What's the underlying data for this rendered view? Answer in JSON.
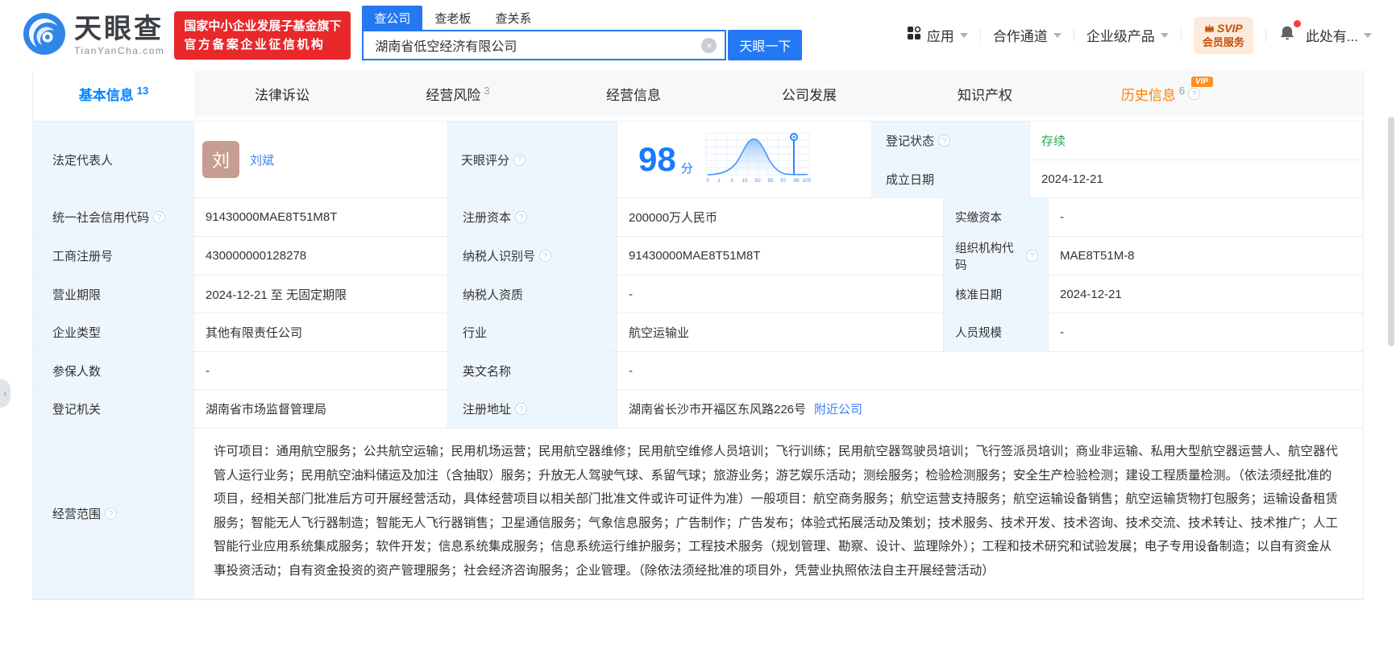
{
  "colors": {
    "primary": "#2478f2",
    "active_tab": "#0084ff",
    "status_green": "#2bab4e",
    "history_orange": "#ff8000",
    "label_bg": "#eef6fd",
    "badge_red": "#e8282b",
    "score_blue": "#187aff"
  },
  "icons": {
    "help_glyph": "?",
    "clear_glyph": "×",
    "side_toggle_glyph": "‹"
  },
  "header": {
    "logo": {
      "title": "天眼查",
      "domain": "TianYanCha.com"
    },
    "cert_badge": {
      "line1": "国家中小企业发展子基金旗下",
      "line2": "官方备案企业征信机构"
    },
    "search": {
      "tabs": [
        {
          "label": "查公司",
          "active": true
        },
        {
          "label": "查老板",
          "active": false
        },
        {
          "label": "查关系",
          "active": false
        }
      ],
      "value": "湖南省低空经济有限公司",
      "button": "天眼一下"
    },
    "nav": {
      "apps": "应用",
      "partner": "合作通道",
      "enterprise": "企业级产品",
      "vip_top": "SVIP",
      "vip_bottom": "会员服务",
      "account": "此处有..."
    }
  },
  "tabs": [
    {
      "label": "基本信息",
      "count": "13"
    },
    {
      "label": "法律诉讼",
      "count": ""
    },
    {
      "label": "经营风险",
      "count": "3"
    },
    {
      "label": "经营信息",
      "count": ""
    },
    {
      "label": "公司发展",
      "count": ""
    },
    {
      "label": "知识产权",
      "count": ""
    },
    {
      "label": "历史信息",
      "count": "6",
      "vip_badge": "VIP"
    }
  ],
  "profile": {
    "legal_rep": {
      "label": "法定代表人",
      "avatar": "刘",
      "name": "刘斌"
    },
    "reg_status": {
      "label": "登记状态",
      "value": "存续"
    },
    "establish_date": {
      "label": "成立日期",
      "value": "2024-12-21"
    },
    "score": {
      "label": "天眼评分",
      "value": "98",
      "unit": "分",
      "chart": {
        "type": "area",
        "marker_value": 98,
        "ticks": [
          "0",
          "1",
          "3",
          "15",
          "50",
          "85",
          "97",
          "99",
          "100"
        ]
      }
    },
    "credit_code": {
      "label": "统一社会信用代码",
      "value": "91430000MAE8T51M8T"
    },
    "reg_capital": {
      "label": "注册资本",
      "value": "200000万人民币"
    },
    "paid_capital": {
      "label": "实缴资本",
      "value": "-"
    },
    "reg_number": {
      "label": "工商注册号",
      "value": "430000000128278"
    },
    "taxpayer_id": {
      "label": "纳税人识别号",
      "value": "91430000MAE8T51M8T"
    },
    "org_code": {
      "label": "组织机构代码",
      "value": "MAE8T51M-8"
    },
    "business_term": {
      "label": "营业期限",
      "value": "2024-12-21 至 无固定期限"
    },
    "taxpayer_quality": {
      "label": "纳税人资质",
      "value": "-"
    },
    "approval_date": {
      "label": "核准日期",
      "value": "2024-12-21"
    },
    "company_type": {
      "label": "企业类型",
      "value": "其他有限责任公司"
    },
    "industry": {
      "label": "行业",
      "value": "航空运输业"
    },
    "staff_size": {
      "label": "人员规模",
      "value": "-"
    },
    "insured_count": {
      "label": "参保人数",
      "value": "-"
    },
    "english_name": {
      "label": "英文名称",
      "value": "-"
    },
    "reg_authority": {
      "label": "登记机关",
      "value": "湖南省市场监督管理局"
    },
    "reg_address": {
      "label": "注册地址",
      "value": "湖南省长沙市开福区东风路226号",
      "nearby_link": "附近公司"
    },
    "business_scope": {
      "label": "经营范围",
      "value": "许可项目：通用航空服务；公共航空运输；民用机场运营；民用航空器维修；民用航空维修人员培训；飞行训练；民用航空器驾驶员培训；飞行签派员培训；商业非运输、私用大型航空器运营人、航空器代管人运行业务；民用航空油料储运及加注（含抽取）服务；升放无人驾驶气球、系留气球；旅游业务；游艺娱乐活动；测绘服务；检验检测服务；安全生产检验检测；建设工程质量检测。（依法须经批准的项目，经相关部门批准后方可开展经营活动，具体经营项目以相关部门批准文件或许可证件为准）一般项目：航空商务服务；航空运营支持服务；航空运输设备销售；航空运输货物打包服务；运输设备租赁服务；智能无人飞行器制造；智能无人飞行器销售；卫星通信服务；气象信息服务；广告制作；广告发布；体验式拓展活动及策划；技术服务、技术开发、技术咨询、技术交流、技术转让、技术推广；人工智能行业应用系统集成服务；软件开发；信息系统集成服务；信息系统运行维护服务；工程技术服务（规划管理、勘察、设计、监理除外）；工程和技术研究和试验发展；电子专用设备制造；以自有资金从事投资活动；自有资金投资的资产管理服务；社会经济咨询服务；企业管理。（除依法须经批准的项目外，凭营业执照依法自主开展经营活动）"
    }
  }
}
